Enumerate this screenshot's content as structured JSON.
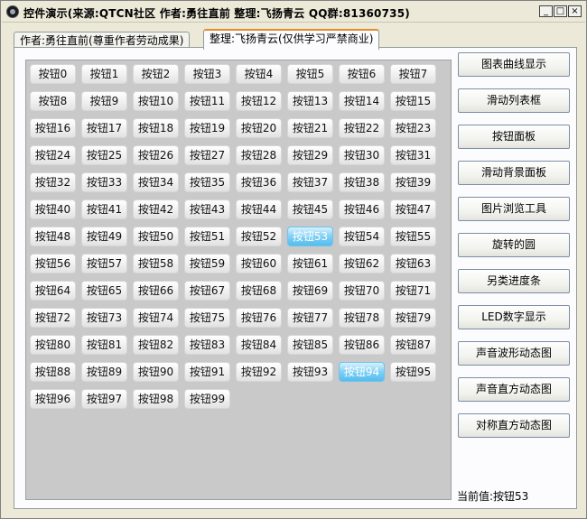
{
  "window": {
    "title": "控件演示(来源:QTCN社区 作者:勇往直前 整理:飞扬青云 QQ群:81360735)",
    "minimize": "_",
    "maximize": "□",
    "close": "×"
  },
  "tabs": [
    {
      "label": "作者:勇往直前(尊重作者劳动成果)"
    },
    {
      "label": "整理:飞扬青云(仅供学习严禁商业)"
    }
  ],
  "grid": {
    "buttons": [
      "按钮0",
      "按钮1",
      "按钮2",
      "按钮3",
      "按钮4",
      "按钮5",
      "按钮6",
      "按钮7",
      "按钮8",
      "按钮9",
      "按钮10",
      "按钮11",
      "按钮12",
      "按钮13",
      "按钮14",
      "按钮15",
      "按钮16",
      "按钮17",
      "按钮18",
      "按钮19",
      "按钮20",
      "按钮21",
      "按钮22",
      "按钮23",
      "按钮24",
      "按钮25",
      "按钮26",
      "按钮27",
      "按钮28",
      "按钮29",
      "按钮30",
      "按钮31",
      "按钮32",
      "按钮33",
      "按钮34",
      "按钮35",
      "按钮36",
      "按钮37",
      "按钮38",
      "按钮39",
      "按钮40",
      "按钮41",
      "按钮42",
      "按钮43",
      "按钮44",
      "按钮45",
      "按钮46",
      "按钮47",
      "按钮48",
      "按钮49",
      "按钮50",
      "按钮51",
      "按钮52",
      "按钮53",
      "按钮54",
      "按钮55",
      "按钮56",
      "按钮57",
      "按钮58",
      "按钮59",
      "按钮60",
      "按钮61",
      "按钮62",
      "按钮63",
      "按钮64",
      "按钮65",
      "按钮66",
      "按钮67",
      "按钮68",
      "按钮69",
      "按钮70",
      "按钮71",
      "按钮72",
      "按钮73",
      "按钮74",
      "按钮75",
      "按钮76",
      "按钮77",
      "按钮78",
      "按钮79",
      "按钮80",
      "按钮81",
      "按钮82",
      "按钮83",
      "按钮84",
      "按钮85",
      "按钮86",
      "按钮87",
      "按钮88",
      "按钮89",
      "按钮90",
      "按钮91",
      "按钮92",
      "按钮93",
      "按钮94",
      "按钮95",
      "按钮96",
      "按钮97",
      "按钮98",
      "按钮99"
    ],
    "highlighted": [
      53,
      94
    ],
    "highlight_color": "#66c6f2"
  },
  "side_buttons": [
    {
      "label": "图表曲线显示"
    },
    {
      "label": "滑动列表框"
    },
    {
      "label": "按钮面板"
    },
    {
      "label": "滑动背景面板"
    },
    {
      "label": "图片浏览工具"
    },
    {
      "label": "旋转的圆"
    },
    {
      "label": "另类进度条"
    },
    {
      "label": "LED数字显示"
    },
    {
      "label": "声音波形动态图"
    },
    {
      "label": "声音直方动态图"
    },
    {
      "label": "对称直方动态图"
    }
  ],
  "status": {
    "current_label": "当前值:",
    "current_value": "按钮53"
  }
}
